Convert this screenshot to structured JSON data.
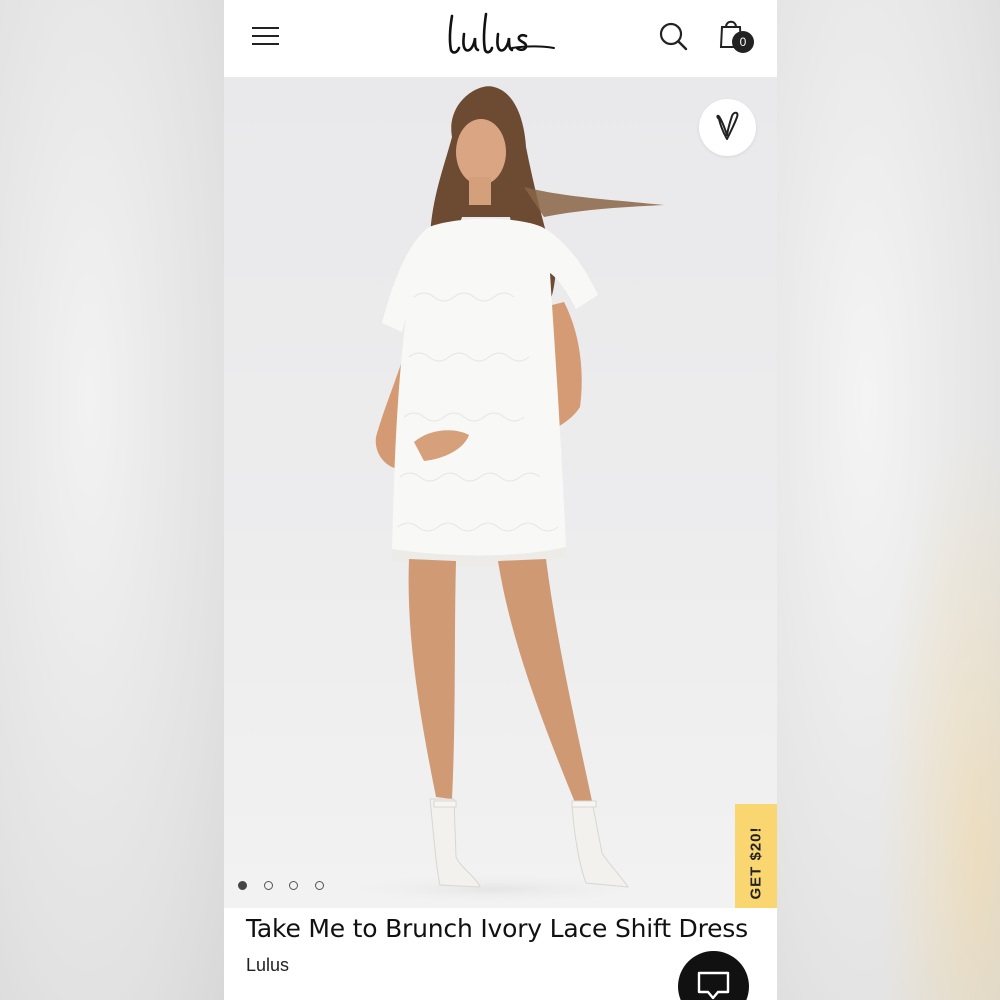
{
  "header": {
    "brand": "Lulus",
    "cart_count": "0",
    "icons": [
      "menu-icon",
      "search-icon",
      "shopping-bag-icon"
    ]
  },
  "product": {
    "title": "Take Me to Brunch Ivory Lace Shift Dress",
    "brand": "Lulus",
    "image_count": 4,
    "active_image_index": 0
  },
  "promo": {
    "label": "GET $20!",
    "color": "#fad670"
  },
  "actions": {
    "favorite_icon": "heart-icon",
    "chat_icon": "chat-bubble-icon"
  }
}
